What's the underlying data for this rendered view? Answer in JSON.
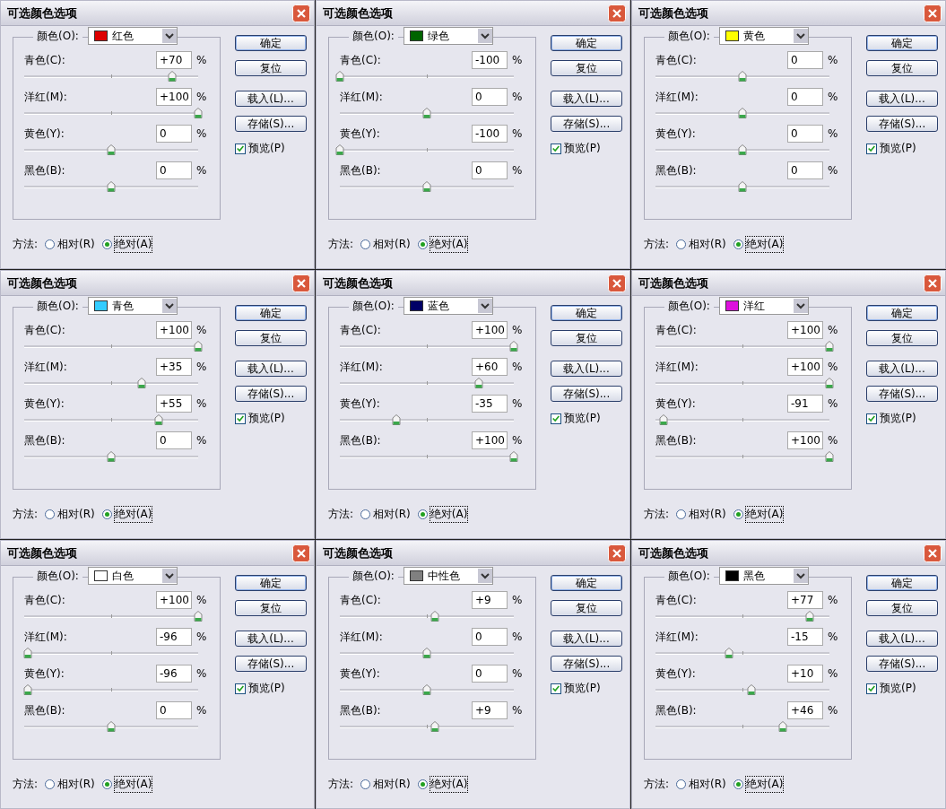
{
  "dialogs": [
    {
      "title": "可选颜色选项",
      "color_label": "颜色(O):",
      "color_name": "红色",
      "color": "#dd0000",
      "sliders": [
        {
          "label": "青色(C):",
          "value": "+70",
          "level": 0.85
        },
        {
          "label": "洋红(M):",
          "value": "+100",
          "level": 1
        },
        {
          "label": "黄色(Y):",
          "value": "0",
          "level": 0.5
        },
        {
          "label": "黑色(B):",
          "value": "0",
          "level": 0.5
        }
      ],
      "unit": "%",
      "buttons": [
        "确定",
        "复位",
        "载入(L)...",
        "存储(S)..."
      ],
      "preview": {
        "label": "预览(P)",
        "checked": true
      },
      "method_label": "方法:",
      "methods": [
        {
          "label": "相对(R)",
          "selected": false
        },
        {
          "label": "绝对(A)",
          "selected": true
        }
      ]
    },
    {
      "title": "可选颜色选项",
      "color_label": "颜色(O):",
      "color_name": "绿色",
      "color": "#006400",
      "sliders": [
        {
          "label": "青色(C):",
          "value": "-100",
          "level": 0
        },
        {
          "label": "洋红(M):",
          "value": "0",
          "level": 0.5
        },
        {
          "label": "黄色(Y):",
          "value": "-100",
          "level": 0
        },
        {
          "label": "黑色(B):",
          "value": "0",
          "level": 0.5
        }
      ],
      "unit": "%",
      "buttons": [
        "确定",
        "复位",
        "载入(L)...",
        "存储(S)..."
      ],
      "preview": {
        "label": "预览(P)",
        "checked": true
      },
      "method_label": "方法:",
      "methods": [
        {
          "label": "相对(R)",
          "selected": false
        },
        {
          "label": "绝对(A)",
          "selected": true
        }
      ]
    },
    {
      "title": "可选颜色选项",
      "color_label": "颜色(O):",
      "color_name": "黄色",
      "color": "#ffff00",
      "sliders": [
        {
          "label": "青色(C):",
          "value": "0",
          "level": 0.5
        },
        {
          "label": "洋红(M):",
          "value": "0",
          "level": 0.5
        },
        {
          "label": "黄色(Y):",
          "value": "0",
          "level": 0.5
        },
        {
          "label": "黑色(B):",
          "value": "0",
          "level": 0.5
        }
      ],
      "unit": "%",
      "buttons": [
        "确定",
        "复位",
        "载入(L)...",
        "存储(S)..."
      ],
      "preview": {
        "label": "预览(P)",
        "checked": true
      },
      "method_label": "方法:",
      "methods": [
        {
          "label": "相对(R)",
          "selected": false
        },
        {
          "label": "绝对(A)",
          "selected": true
        }
      ]
    },
    {
      "title": "可选颜色选项",
      "color_label": "颜色(O):",
      "color_name": "青色",
      "color": "#33ccff",
      "sliders": [
        {
          "label": "青色(C):",
          "value": "+100",
          "level": 1
        },
        {
          "label": "洋红(M):",
          "value": "+35",
          "level": 0.675
        },
        {
          "label": "黄色(Y):",
          "value": "+55",
          "level": 0.775
        },
        {
          "label": "黑色(B):",
          "value": "0",
          "level": 0.5
        }
      ],
      "unit": "%",
      "buttons": [
        "确定",
        "复位",
        "载入(L)...",
        "存储(S)..."
      ],
      "preview": {
        "label": "预览(P)",
        "checked": true
      },
      "method_label": "方法:",
      "methods": [
        {
          "label": "相对(R)",
          "selected": false
        },
        {
          "label": "绝对(A)",
          "selected": true
        }
      ]
    },
    {
      "title": "可选颜色选项",
      "color_label": "颜色(O):",
      "color_name": "蓝色",
      "color": "#000066",
      "sliders": [
        {
          "label": "青色(C):",
          "value": "+100",
          "level": 1
        },
        {
          "label": "洋红(M):",
          "value": "+60",
          "level": 0.8
        },
        {
          "label": "黄色(Y):",
          "value": "-35",
          "level": 0.325
        },
        {
          "label": "黑色(B):",
          "value": "+100",
          "level": 1
        }
      ],
      "unit": "%",
      "buttons": [
        "确定",
        "复位",
        "载入(L)...",
        "存储(S)..."
      ],
      "preview": {
        "label": "预览(P)",
        "checked": true
      },
      "method_label": "方法:",
      "methods": [
        {
          "label": "相对(R)",
          "selected": false
        },
        {
          "label": "绝对(A)",
          "selected": true
        }
      ]
    },
    {
      "title": "可选颜色选项",
      "color_label": "颜色(O):",
      "color_name": "洋红",
      "color": "#dd11dd",
      "sliders": [
        {
          "label": "青色(C):",
          "value": "+100",
          "level": 1
        },
        {
          "label": "洋红(M):",
          "value": "+100",
          "level": 1
        },
        {
          "label": "黄色(Y):",
          "value": "-91",
          "level": 0.045
        },
        {
          "label": "黑色(B):",
          "value": "+100",
          "level": 1
        }
      ],
      "unit": "%",
      "buttons": [
        "确定",
        "复位",
        "载入(L)...",
        "存储(S)..."
      ],
      "preview": {
        "label": "预览(P)",
        "checked": true
      },
      "method_label": "方法:",
      "methods": [
        {
          "label": "相对(R)",
          "selected": false
        },
        {
          "label": "绝对(A)",
          "selected": true
        }
      ]
    },
    {
      "title": "可选颜色选项",
      "color_label": "颜色(O):",
      "color_name": "白色",
      "color": "#ffffff",
      "sliders": [
        {
          "label": "青色(C):",
          "value": "+100",
          "level": 1
        },
        {
          "label": "洋红(M):",
          "value": "-96",
          "level": 0.02
        },
        {
          "label": "黄色(Y):",
          "value": "-96",
          "level": 0.02
        },
        {
          "label": "黑色(B):",
          "value": "0",
          "level": 0.5
        }
      ],
      "unit": "%",
      "buttons": [
        "确定",
        "复位",
        "载入(L)...",
        "存储(S)..."
      ],
      "preview": {
        "label": "预览(P)",
        "checked": true
      },
      "method_label": "方法:",
      "methods": [
        {
          "label": "相对(R)",
          "selected": false
        },
        {
          "label": "绝对(A)",
          "selected": true
        }
      ]
    },
    {
      "title": "可选颜色选项",
      "color_label": "颜色(O):",
      "color_name": "中性色",
      "color": "#808080",
      "sliders": [
        {
          "label": "青色(C):",
          "value": "+9",
          "level": 0.545
        },
        {
          "label": "洋红(M):",
          "value": "0",
          "level": 0.5
        },
        {
          "label": "黄色(Y):",
          "value": "0",
          "level": 0.5
        },
        {
          "label": "黑色(B):",
          "value": "+9",
          "level": 0.545
        }
      ],
      "unit": "%",
      "buttons": [
        "确定",
        "复位",
        "载入(L)...",
        "存储(S)..."
      ],
      "preview": {
        "label": "预览(P)",
        "checked": true
      },
      "method_label": "方法:",
      "methods": [
        {
          "label": "相对(R)",
          "selected": false
        },
        {
          "label": "绝对(A)",
          "selected": true
        }
      ]
    },
    {
      "title": "可选颜色选项",
      "color_label": "颜色(O):",
      "color_name": "黑色",
      "color": "#000000",
      "sliders": [
        {
          "label": "青色(C):",
          "value": "+77",
          "level": 0.885
        },
        {
          "label": "洋红(M):",
          "value": "-15",
          "level": 0.425
        },
        {
          "label": "黄色(Y):",
          "value": "+10",
          "level": 0.55
        },
        {
          "label": "黑色(B):",
          "value": "+46",
          "level": 0.73
        }
      ],
      "unit": "%",
      "buttons": [
        "确定",
        "复位",
        "载入(L)...",
        "存储(S)..."
      ],
      "preview": {
        "label": "预览(P)",
        "checked": true
      },
      "method_label": "方法:",
      "methods": [
        {
          "label": "相对(R)",
          "selected": false
        },
        {
          "label": "绝对(A)",
          "selected": true
        }
      ]
    }
  ]
}
